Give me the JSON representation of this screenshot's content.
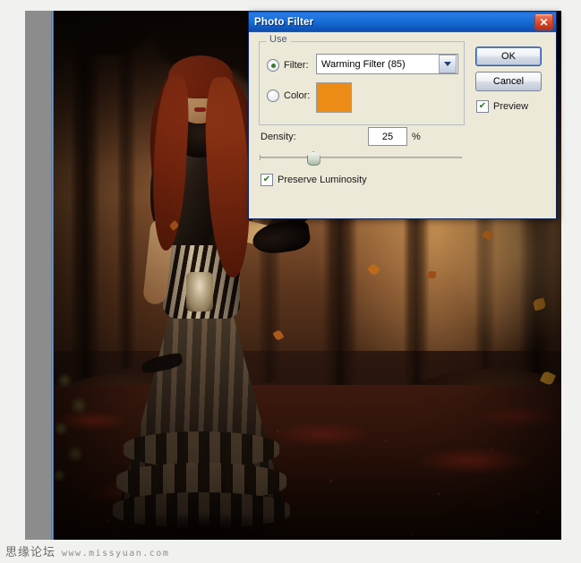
{
  "dialog": {
    "title": "Photo Filter",
    "close_icon": "close-icon",
    "use_group": {
      "legend": "Use",
      "filter_radio_label": "Filter:",
      "filter_selected": "Warming Filter (85)",
      "filter_options": [
        "Warming Filter (85)"
      ],
      "color_radio_label": "Color:",
      "color_swatch_hex": "#EC8C17",
      "selected_option": "filter",
      "dropdown_icon": "chevron-down-icon"
    },
    "density": {
      "label": "Density:",
      "value": "25",
      "unit": "%",
      "slider_percent": 25
    },
    "preserve_luminosity": {
      "label": "Preserve Luminosity",
      "checked": true
    },
    "buttons": {
      "ok": "OK",
      "cancel": "Cancel"
    },
    "preview": {
      "label": "Preview",
      "checked": true
    }
  },
  "watermark": {
    "chinese": "思缘论坛",
    "url": "www.missyuan.com"
  }
}
